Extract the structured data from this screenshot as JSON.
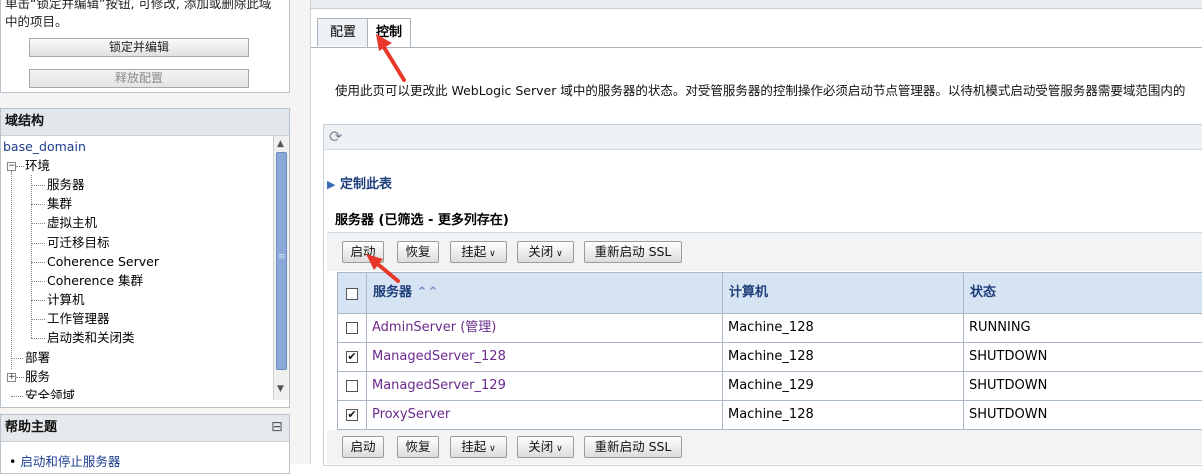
{
  "change_center": {
    "help_text_line1": "单击“锁定并编辑”按钮, 可修改, 添加或删除此域",
    "help_text_line2": "中的项目。",
    "lock_button": "锁定并编辑",
    "release_button": "释放配置"
  },
  "domain_structure": {
    "title": "域结构",
    "root": "base_domain",
    "items": [
      {
        "label": "环境",
        "expander": "−"
      },
      {
        "label": "服务器"
      },
      {
        "label": "集群"
      },
      {
        "label": "虚拟主机"
      },
      {
        "label": "可迁移目标"
      },
      {
        "label": "Coherence Server"
      },
      {
        "label": "Coherence 集群"
      },
      {
        "label": "计算机"
      },
      {
        "label": "工作管理器"
      },
      {
        "label": "启动类和关闭类"
      },
      {
        "label": "部署"
      },
      {
        "label": "服务",
        "expander": "+"
      },
      {
        "label": "安全领域"
      }
    ]
  },
  "help_topics": {
    "title": "帮助主题",
    "collapse_glyph": "⊟",
    "items": [
      "启动和停止服务器"
    ]
  },
  "tabs": [
    {
      "label": "配置",
      "active": false
    },
    {
      "label": "控制",
      "active": true
    }
  ],
  "description": "使用此页可以更改此 WebLogic Server 域中的服务器的状态。对受管服务器的控制操作必须启动节点管理器。以待机模式启动受管服务器需要域范围内的",
  "customize_link": "定制此表",
  "table_title": "服务器 (已筛选 - 更多列存在)",
  "actions": {
    "start": "启动",
    "resume": "恢复",
    "suspend": "挂起",
    "shutdown": "关闭",
    "restart_ssl": "重新启动 SSL"
  },
  "table": {
    "columns": [
      "服务器",
      "计算机",
      "状态"
    ],
    "rows": [
      {
        "server": "AdminServer (管理)",
        "machine": "Machine_128",
        "state": "RUNNING",
        "checked": false
      },
      {
        "server": "ManagedServer_128",
        "machine": "Machine_128",
        "state": "SHUTDOWN",
        "checked": true
      },
      {
        "server": "ManagedServer_129",
        "machine": "Machine_129",
        "state": "SHUTDOWN",
        "checked": false
      },
      {
        "server": "ProxyServer",
        "machine": "Machine_128",
        "state": "SHUTDOWN",
        "checked": true
      }
    ]
  },
  "colors": {
    "annotation_arrow": "#e8382a",
    "header_bg": "#d6e3f3",
    "link": "#6b2a8c"
  }
}
